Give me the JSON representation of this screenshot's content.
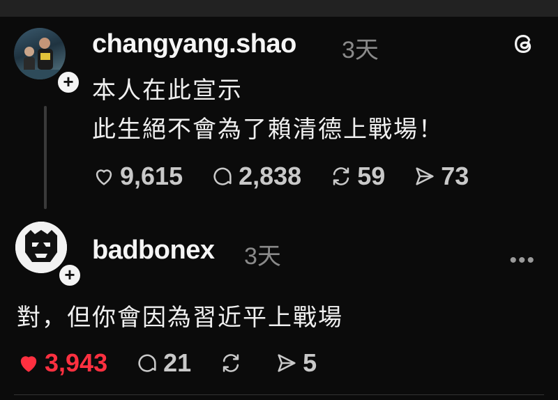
{
  "post1": {
    "username": "changyang.shao",
    "time": "3天",
    "lines": [
      "本人在此宣示",
      "此生絕不會為了賴清德上戰場！"
    ],
    "likes": "9,615",
    "comments": "2,838",
    "reposts": "59",
    "shares": "73"
  },
  "post2": {
    "username": "badbonex",
    "time": "3天",
    "text": "對，但你會因為習近平上戰場",
    "likes": "3,943",
    "comments": "21",
    "shares": "5",
    "liked": true
  },
  "colors": {
    "liked": "#ff3040",
    "muted": "#8a8a8a",
    "background": "#0b0b0b"
  },
  "icons": [
    "threads-logo-icon",
    "heart-icon",
    "comment-icon",
    "repost-icon",
    "share-icon",
    "more-icon",
    "follow-plus-icon"
  ]
}
